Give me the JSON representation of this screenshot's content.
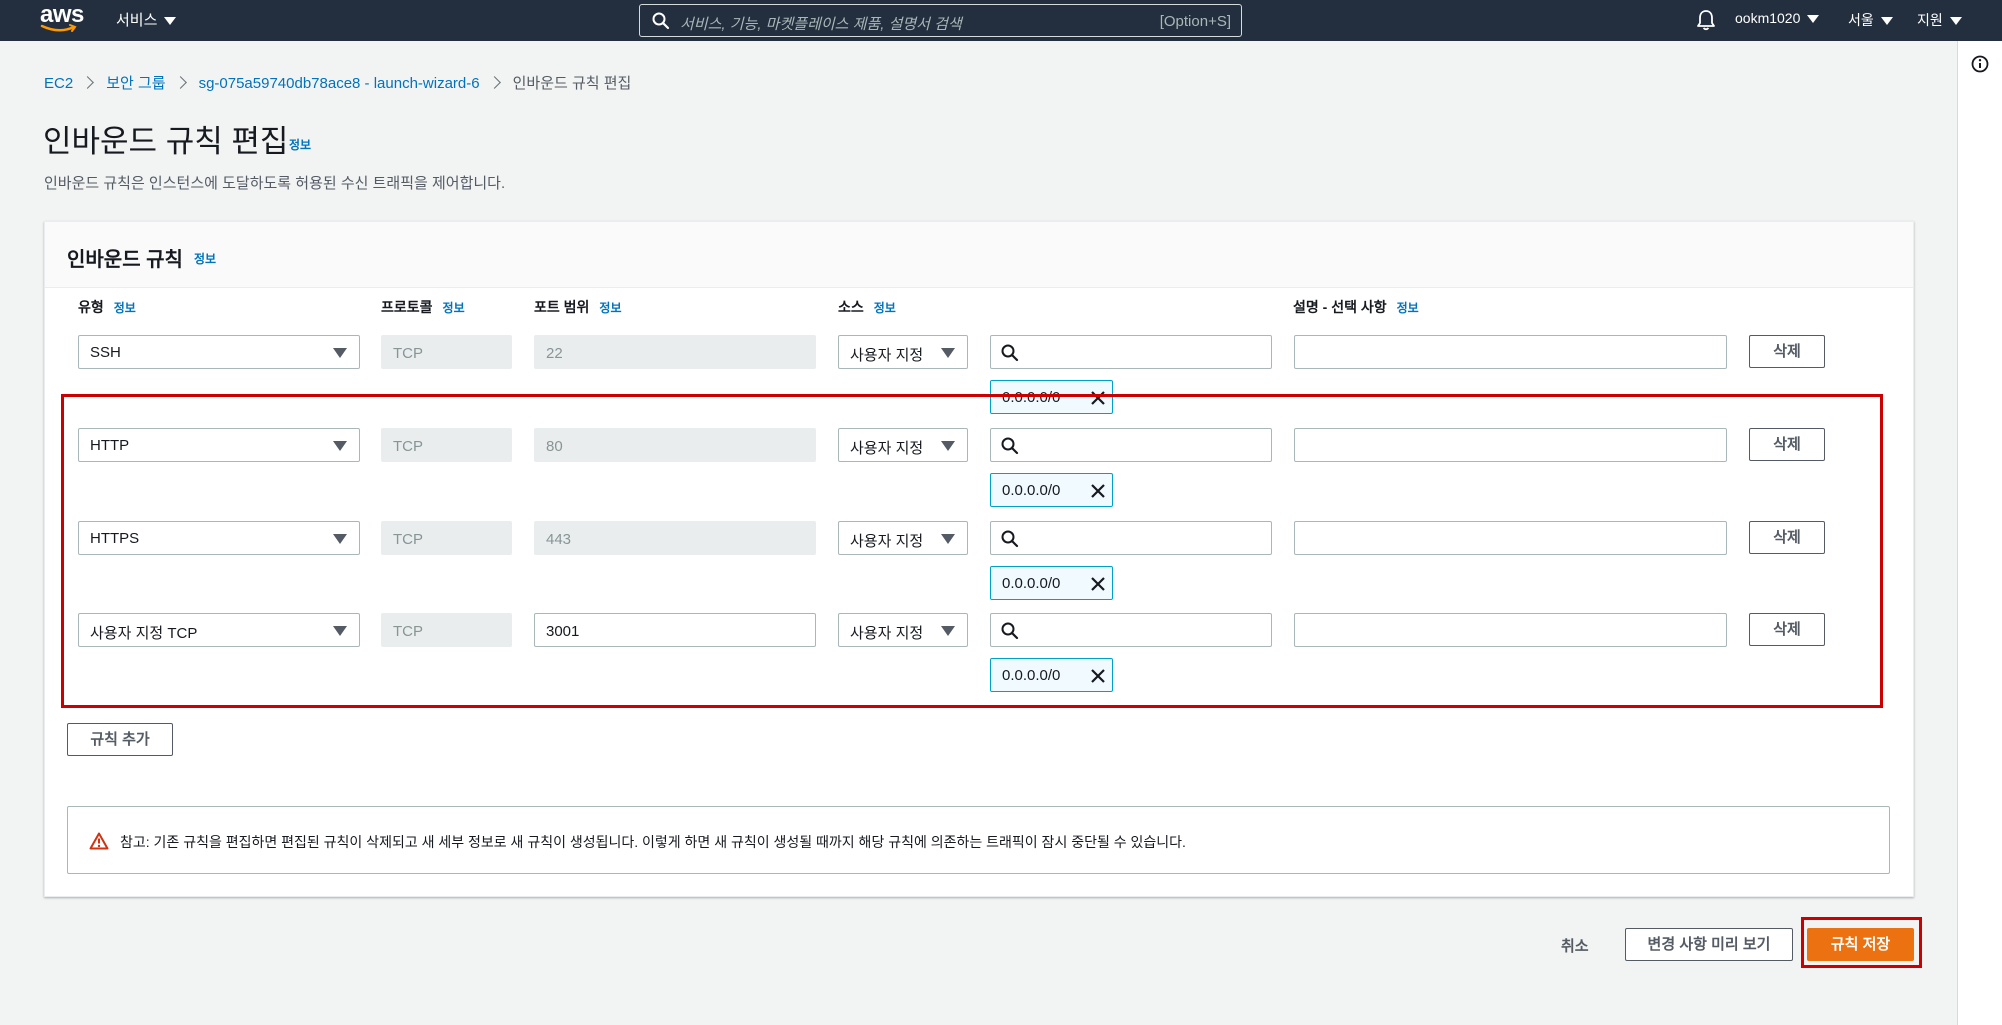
{
  "topnav": {
    "logo_text": "aws",
    "services_label": "서비스",
    "search_placeholder": "서비스, 기능, 마켓플레이스 제품, 설명서 검색",
    "search_shortcut": "[Option+S]",
    "user": "ookm1020",
    "region": "서울",
    "support": "지원"
  },
  "breadcrumb": {
    "items": [
      "EC2",
      "보안 그룹",
      "sg-075a59740db78ace8 - launch-wizard-6"
    ],
    "current": "인바운드 규칙 편집"
  },
  "page": {
    "title": "인바운드 규칙 편집",
    "info": "정보",
    "description": "인바운드 규칙은 인스턴스에 도달하도록 허용된 수신 트래픽을 제어합니다."
  },
  "panel": {
    "title": "인바운드 규칙",
    "info": "정보",
    "columns": {
      "type": "유형",
      "protocol": "프로토콜",
      "port_range": "포트 범위",
      "source": "소스",
      "description": "설명 - 선택 사항",
      "info": "정보"
    },
    "rules": [
      {
        "type": "SSH",
        "protocol": "TCP",
        "port": "22",
        "source_type": "사용자 지정",
        "cidr": "0.0.0.0/0",
        "description": "",
        "delete": "삭제"
      },
      {
        "type": "HTTP",
        "protocol": "TCP",
        "port": "80",
        "source_type": "사용자 지정",
        "cidr": "0.0.0.0/0",
        "description": "",
        "delete": "삭제"
      },
      {
        "type": "HTTPS",
        "protocol": "TCP",
        "port": "443",
        "source_type": "사용자 지정",
        "cidr": "0.0.0.0/0",
        "description": "",
        "delete": "삭제"
      },
      {
        "type": "사용자 지정 TCP",
        "protocol": "TCP",
        "port": "3001",
        "source_type": "사용자 지정",
        "cidr": "0.0.0.0/0",
        "description": "",
        "delete": "삭제"
      }
    ],
    "add_rule": "규칙 추가",
    "note": "참고: 기존 규칙을 편집하면 편집된 규칙이 삭제되고 새 세부 정보로 새 규칙이 생성됩니다. 이렇게 하면 새 규칙이 생성될 때까지 해당 규칙에 의존하는 트래픽이 잠시 중단될 수 있습니다."
  },
  "footer": {
    "cancel": "취소",
    "preview": "변경 사항 미리 보기",
    "save": "규칙 저장"
  },
  "colors": {
    "nav_bg": "#232f3e",
    "link": "#0073bb",
    "primary": "#ec7211",
    "highlight": "#cc0000"
  },
  "icons": [
    "search-icon",
    "bell-icon",
    "info-circle-icon",
    "chevron-right-icon",
    "close-icon",
    "warning-icon",
    "caret-down-icon"
  ]
}
